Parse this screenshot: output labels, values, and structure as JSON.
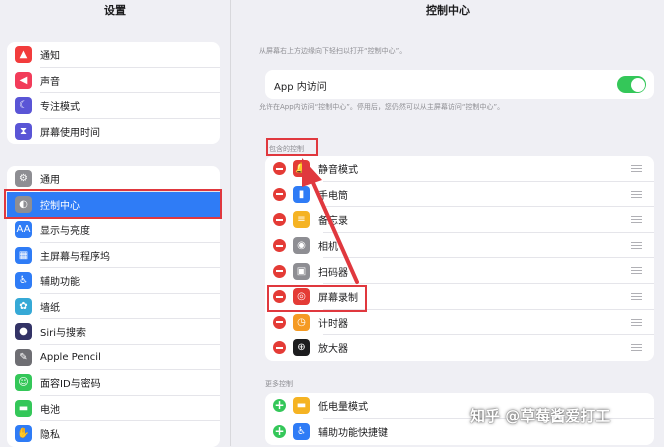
{
  "left": {
    "title": "设置",
    "group1": [
      {
        "label": "通知",
        "icon": "bell-icon",
        "color": "#f23c3c",
        "glyph": "▲"
      },
      {
        "label": "声音",
        "icon": "speaker-icon",
        "color": "#f23c5a",
        "glyph": "◀"
      },
      {
        "label": "专注模式",
        "icon": "moon-icon",
        "color": "#5a55d6",
        "glyph": "☾"
      },
      {
        "label": "屏幕使用时间",
        "icon": "hourglass-icon",
        "color": "#5a55d6",
        "glyph": "⧗"
      }
    ],
    "group2": [
      {
        "label": "通用",
        "icon": "gear-icon",
        "color": "#8e8e93",
        "glyph": "⚙"
      },
      {
        "label": "控制中心",
        "icon": "toggles-icon",
        "color": "#8e8e93",
        "glyph": "◐",
        "selected": true
      },
      {
        "label": "显示与亮度",
        "icon": "text-size-icon",
        "color": "#2f7cf6",
        "glyph": "AA"
      },
      {
        "label": "主屏幕与程序坞",
        "icon": "grid-icon",
        "color": "#2f7cf6",
        "glyph": "▦"
      },
      {
        "label": "辅助功能",
        "icon": "accessibility-icon",
        "color": "#2f7cf6",
        "glyph": "♿"
      },
      {
        "label": "墙纸",
        "icon": "flower-icon",
        "color": "#36a9d6",
        "glyph": "✿"
      },
      {
        "label": "Siri与搜索",
        "icon": "siri-icon",
        "color": "#333366",
        "glyph": "●"
      },
      {
        "label": "Apple Pencil",
        "icon": "pencil-icon",
        "color": "#6e6e73",
        "glyph": "✎"
      },
      {
        "label": "面容ID与密码",
        "icon": "faceid-icon",
        "color": "#34c759",
        "glyph": "☺"
      },
      {
        "label": "电池",
        "icon": "battery-icon",
        "color": "#34c759",
        "glyph": "▬"
      },
      {
        "label": "隐私",
        "icon": "hand-icon",
        "color": "#2f7cf6",
        "glyph": "✋"
      }
    ]
  },
  "right": {
    "title": "控制中心",
    "intro": "从屏幕右上方边缘向下轻扫以打开“控制中心”。",
    "app_access": {
      "label": "App 内访问",
      "on": true
    },
    "app_access_note": "允许在App内访问“控制中心”。停用后，您仍然可以从主屏幕访问“控制中心”。",
    "included_header": "包含的控制",
    "included": [
      {
        "label": "静音模式",
        "icon": "bell-icon",
        "color": "#e43b36",
        "glyph": "🔔"
      },
      {
        "label": "手电筒",
        "icon": "flashlight-icon",
        "color": "#2f7cf6",
        "glyph": "▮"
      },
      {
        "label": "备忘录",
        "icon": "notes-icon",
        "color": "#f5b323",
        "glyph": "≡"
      },
      {
        "label": "相机",
        "icon": "camera-icon",
        "color": "#8e8e93",
        "glyph": "◉"
      },
      {
        "label": "扫码器",
        "icon": "qr-scanner-icon",
        "color": "#8e8e93",
        "glyph": "▣"
      },
      {
        "label": "屏幕录制",
        "icon": "record-icon",
        "color": "#e43b36",
        "glyph": "◎"
      },
      {
        "label": "计时器",
        "icon": "timer-icon",
        "color": "#f59a23",
        "glyph": "◷"
      },
      {
        "label": "放大器",
        "icon": "magnifier-icon",
        "color": "#1c1c1e",
        "glyph": "⊕"
      }
    ],
    "more_header": "更多控制",
    "more": [
      {
        "label": "低电量模式",
        "icon": "low-power-icon",
        "color": "#f5b323",
        "glyph": "▬"
      },
      {
        "label": "辅助功能快捷键",
        "icon": "accessibility-icon",
        "color": "#2f7cf6",
        "glyph": "♿"
      }
    ]
  },
  "watermark": "知乎 @草莓酱爱打工",
  "accent_color": "#e0383e"
}
